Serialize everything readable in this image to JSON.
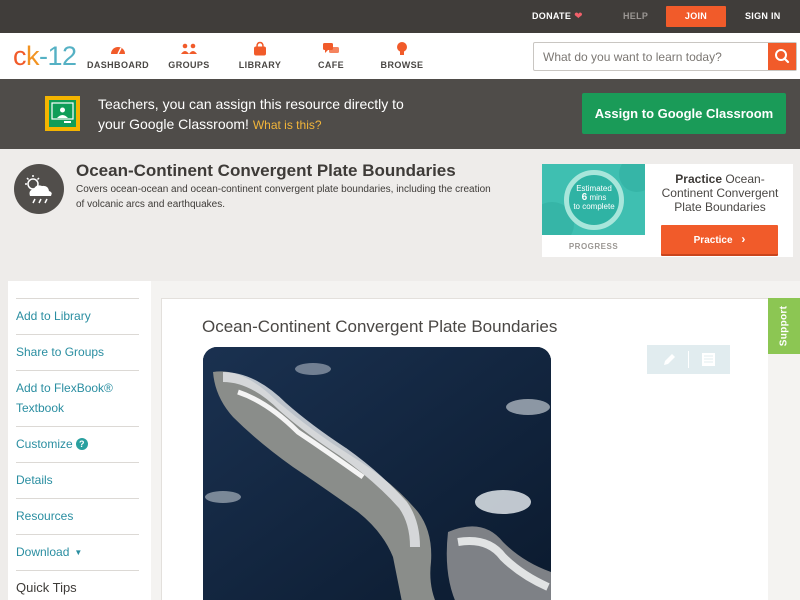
{
  "topbar": {
    "donate": "DONATE",
    "help": "HELP",
    "join": "JOIN",
    "signin": "SIGN IN"
  },
  "header": {
    "logo": {
      "c": "c",
      "dash": "k",
      "twelve": "-12"
    },
    "nav": [
      {
        "label": "DASHBOARD",
        "icon": "dashboard-gauge-icon"
      },
      {
        "label": "GROUPS",
        "icon": "groups-people-icon"
      },
      {
        "label": "LIBRARY",
        "icon": "library-bag-icon"
      },
      {
        "label": "CAFE",
        "icon": "cafe-chat-bubbles-icon"
      },
      {
        "label": "BROWSE",
        "icon": "browse-lightbulb-icon"
      }
    ],
    "search": {
      "placeholder": "What do you want to learn today?",
      "value": ""
    }
  },
  "classroom_banner": {
    "line1": "Teachers, you can assign this resource directly to",
    "line2": "your Google Classroom!",
    "what": "What is this?",
    "button": "Assign to Google Classroom"
  },
  "concept": {
    "title": "Ocean-Continent Convergent Plate Boundaries",
    "description": "Covers ocean-ocean and ocean-continent convergent plate boundaries, including the creation of volcanic arcs and earthquakes.",
    "icon": "weather-cloud-storm-icon"
  },
  "practice": {
    "estimated": "Estimated",
    "mins_number": "6",
    "mins_word": "mins",
    "to_complete": "to complete",
    "progress_label": "PROGRESS",
    "practice_bold": "Practice",
    "practice_rest": " Ocean-Continent Convergent Plate Boundaries",
    "button": "Practice"
  },
  "sidebar": {
    "items": [
      "Add to Library",
      "Share to Groups",
      "Add to FlexBook®",
      "Textbook",
      "Customize",
      "Details",
      "Resources",
      "Download",
      "Quick Tips"
    ]
  },
  "content": {
    "title": "Ocean-Continent Convergent Plate Boundaries",
    "support": "Support"
  },
  "colors": {
    "brand_orange": "#f15b2a",
    "teal_link": "#2a8ea1",
    "google_green": "#1a9b58",
    "support_green": "#8cc653"
  }
}
